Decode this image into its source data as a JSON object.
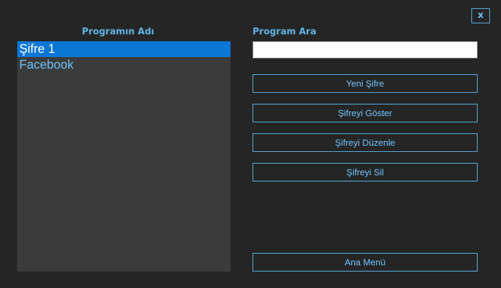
{
  "window": {
    "close_label": "x"
  },
  "program_list": {
    "title": "Programın Adı",
    "items": [
      {
        "label": "Şifre 1",
        "selected": true
      },
      {
        "label": "Facebook",
        "selected": false
      }
    ]
  },
  "search": {
    "title": "Program Ara",
    "value": "",
    "placeholder": ""
  },
  "actions": {
    "new_password": "Yeni Şifre",
    "show_password": "Şifreyi Göster",
    "edit_password": "Şifreyi Düzenle",
    "delete_password": "Şifreyi Sil",
    "main_menu": "Ana Menü"
  },
  "colors": {
    "background": "#252525",
    "listbox_background": "#3b3b3b",
    "accent": "#5bb3e8",
    "selection": "#0a77d5"
  }
}
